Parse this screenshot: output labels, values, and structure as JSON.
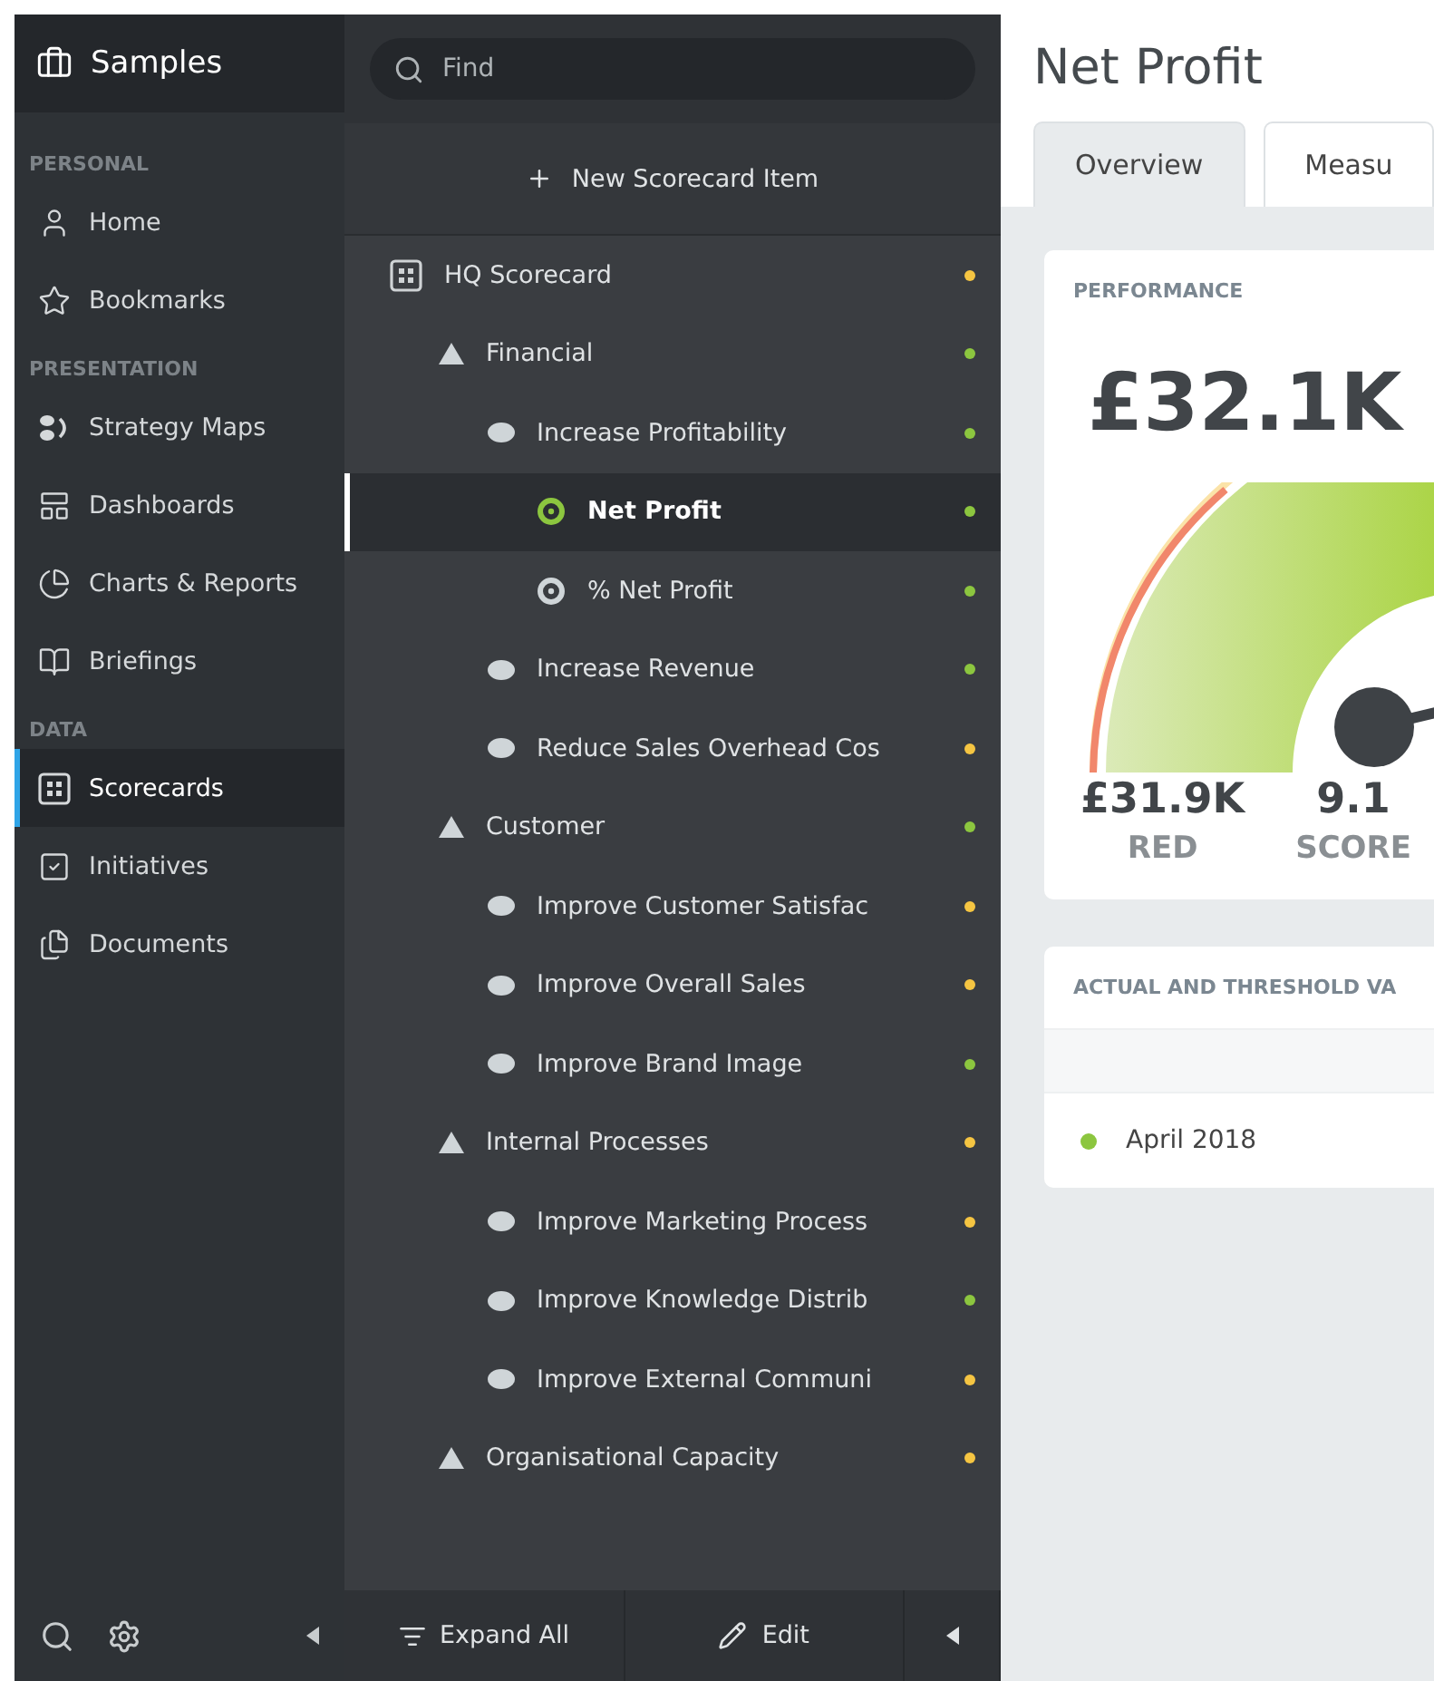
{
  "sidebar": {
    "title": "Samples",
    "sections": [
      {
        "label": "PERSONAL",
        "items": [
          {
            "label": "Home",
            "selected": false
          },
          {
            "label": "Bookmarks",
            "selected": false
          }
        ]
      },
      {
        "label": "PRESENTATION",
        "items": [
          {
            "label": "Strategy Maps",
            "selected": false
          },
          {
            "label": "Dashboards",
            "selected": false
          },
          {
            "label": "Charts & Reports",
            "selected": false
          },
          {
            "label": "Briefings",
            "selected": false
          }
        ]
      },
      {
        "label": "DATA",
        "items": [
          {
            "label": "Scorecards",
            "selected": true
          },
          {
            "label": "Initiatives",
            "selected": false
          },
          {
            "label": "Documents",
            "selected": false
          }
        ]
      }
    ]
  },
  "tree_panel": {
    "search": {
      "placeholder": "Find"
    },
    "new_item": "New Scorecard Item",
    "tree": [
      {
        "kind": "scorecard",
        "label": "HQ Scorecard",
        "color": "#f5c542",
        "selected": false,
        "children": [
          {
            "kind": "perspective",
            "label": "Financial",
            "color": "#8cc63f",
            "selected": false,
            "children": [
              {
                "kind": "objective",
                "label": "Increase Profitability",
                "color": "#8cc63f",
                "selected": false,
                "children": [
                  {
                    "kind": "measure",
                    "label": "Net Profit",
                    "color": "#8cc63f",
                    "selected": true
                  },
                  {
                    "kind": "measure",
                    "label": "% Net Profit",
                    "color": "#8cc63f",
                    "selected": false
                  }
                ]
              },
              {
                "kind": "objective",
                "label": "Increase Revenue",
                "color": "#8cc63f",
                "selected": false
              },
              {
                "kind": "objective",
                "label": "Reduce Sales Overhead Cos",
                "color": "#f5c542",
                "selected": false
              }
            ]
          },
          {
            "kind": "perspective",
            "label": "Customer",
            "color": "#8cc63f",
            "selected": false,
            "children": [
              {
                "kind": "objective",
                "label": "Improve Customer Satisfac",
                "color": "#f5c542",
                "selected": false
              },
              {
                "kind": "objective",
                "label": "Improve Overall Sales",
                "color": "#f5c542",
                "selected": false
              },
              {
                "kind": "objective",
                "label": "Improve Brand Image",
                "color": "#8cc63f",
                "selected": false
              }
            ]
          },
          {
            "kind": "perspective",
            "label": "Internal Processes",
            "color": "#f5c542",
            "selected": false,
            "children": [
              {
                "kind": "objective",
                "label": "Improve Marketing Process",
                "color": "#f5c542",
                "selected": false
              },
              {
                "kind": "objective",
                "label": "Improve Knowledge Distrib",
                "color": "#8cc63f",
                "selected": false
              },
              {
                "kind": "objective",
                "label": "Improve External Communi",
                "color": "#f5c542",
                "selected": false
              }
            ]
          },
          {
            "kind": "perspective",
            "label": "Organisational Capacity",
            "color": "#f5c542",
            "selected": false
          }
        ]
      }
    ],
    "expand_all": "Expand All",
    "edit": "Edit"
  },
  "content": {
    "title": "Net Profit",
    "tabs": [
      {
        "label": "Overview",
        "selected": true
      },
      {
        "label": "Measu",
        "selected": false
      }
    ],
    "performance": {
      "heading": "PERFORMANCE",
      "value": "£32.1K",
      "stats": [
        {
          "value": "£31.9K",
          "label": "RED"
        },
        {
          "value": "9.1",
          "label": "SCORE"
        }
      ]
    },
    "thresholds": {
      "heading": "ACTUAL AND THRESHOLD VA",
      "rows": [
        {
          "label": "April 2018",
          "color": "#8cc63f"
        }
      ]
    }
  }
}
